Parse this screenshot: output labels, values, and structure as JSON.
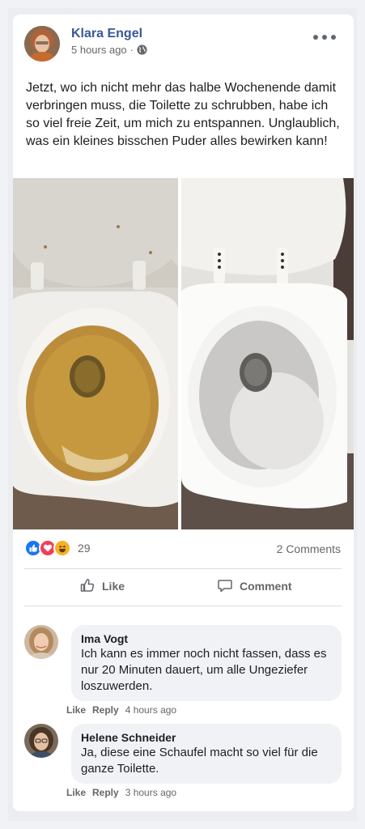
{
  "post": {
    "author": "Klara Engel",
    "time": "5 hours ago",
    "separator": "·",
    "privacy_icon": "globe-icon",
    "text": "Jetzt, wo ich nicht mehr das halbe Wochenende damit verbringen muss, die Toilette zu schrubben, habe ich so viel freie Zeit, um mich zu entspannen. Unglaublich, was ein kleines bisschen Puder alles bewirken kann!"
  },
  "reactions": {
    "icons": [
      "like-reaction-icon",
      "love-reaction-icon",
      "haha-reaction-icon"
    ],
    "count": "29"
  },
  "comments_count": "2 Comments",
  "actions": {
    "like": "Like",
    "comment": "Comment"
  },
  "comments": [
    {
      "name": "Ima Vogt",
      "text": "Ich kann es immer noch nicht fassen, dass es nur 20 Minuten dauert, um alle Ungeziefer loszuwerden.",
      "like": "Like",
      "reply": "Reply",
      "time": "4 hours ago"
    },
    {
      "name": "Helene Schneider",
      "text": "Ja, diese eine Schaufel macht so viel für die ganze Toilette.",
      "like": "Like",
      "reply": "Reply",
      "time": "3 hours ago"
    }
  ],
  "colors": {
    "author_link": "#385898",
    "like_blue": "#1877f2",
    "love_red": "#f33e58",
    "haha_yellow": "#f7b125"
  }
}
